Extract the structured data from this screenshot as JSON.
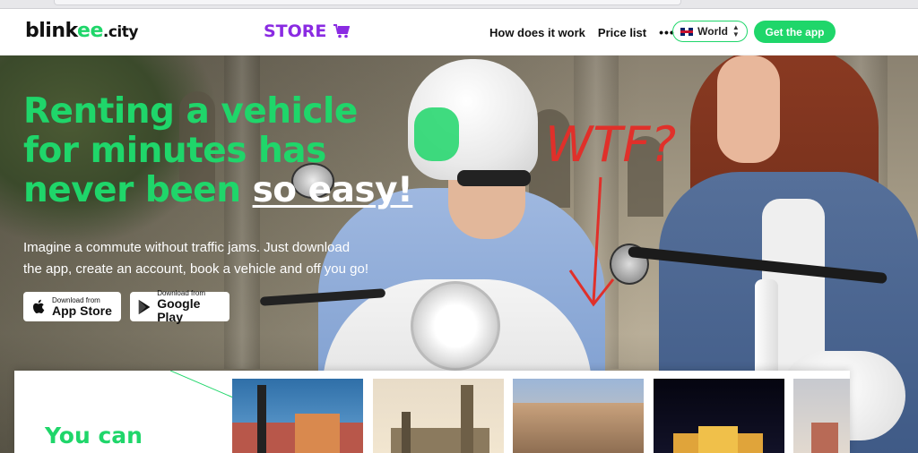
{
  "brand": {
    "logo_main": "blink",
    "logo_accent": "ee",
    "logo_tld": ".city"
  },
  "header": {
    "store_label": "STORE",
    "nav": [
      "How does it work",
      "Price list"
    ],
    "more_label": "•••",
    "region_label": "World",
    "get_app_label": "Get the app"
  },
  "hero": {
    "headline_line1": "Renting a vehicle",
    "headline_line2": "for minutes has",
    "headline_line3_a": "never been ",
    "headline_line3_b": "so easy!",
    "subtitle_line1": "Imagine a commute without traffic jams. Just download",
    "subtitle_line2": "the app, create an account, book a vehicle and off you go!",
    "annotation": "WTF?"
  },
  "badges": {
    "appstore_small": "Download from",
    "appstore_big": "App Store",
    "gplay_small": "Download from",
    "gplay_big": "Google Play"
  },
  "section": {
    "heading": "You can"
  },
  "colors": {
    "accent": "#1fd66a",
    "store": "#8a2be2",
    "annotation": "#e0302a"
  }
}
